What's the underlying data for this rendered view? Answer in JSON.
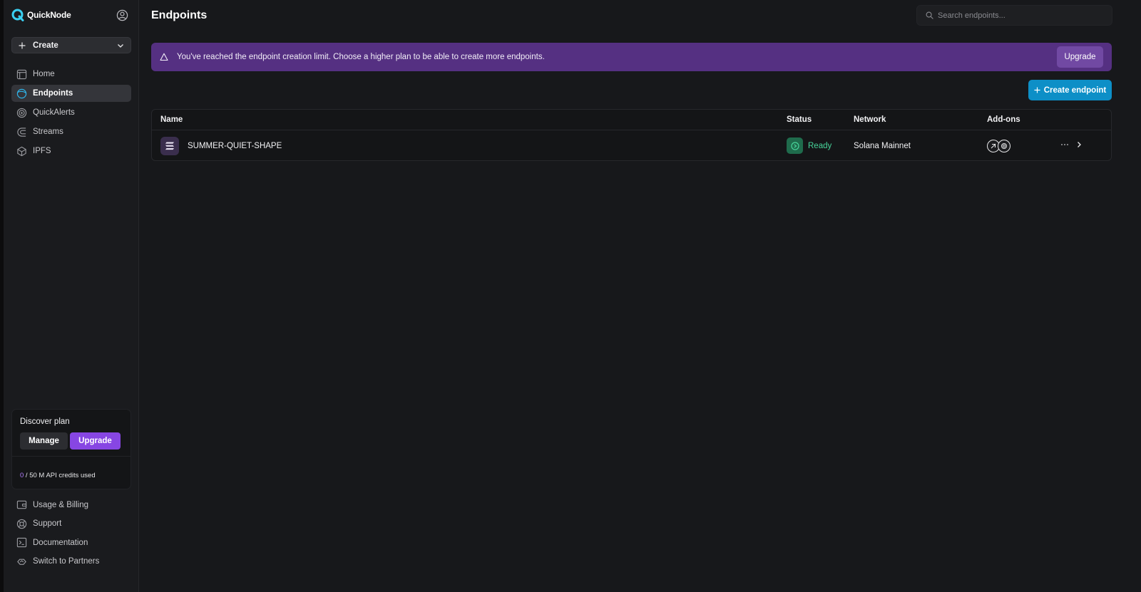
{
  "brand": {
    "name": "QuickNode"
  },
  "sidebar": {
    "create_label": "Create",
    "items": [
      {
        "label": "Home",
        "icon": "home-icon"
      },
      {
        "label": "Endpoints",
        "icon": "endpoints-icon",
        "active": true
      },
      {
        "label": "QuickAlerts",
        "icon": "quickalerts-icon"
      },
      {
        "label": "Streams",
        "icon": "streams-icon"
      },
      {
        "label": "IPFS",
        "icon": "ipfs-icon"
      }
    ],
    "plan": {
      "title": "Discover plan",
      "manage_label": "Manage",
      "upgrade_label": "Upgrade",
      "credits_used": "0",
      "credits_rest": " / 50 M API credits used"
    },
    "bottom_items": [
      {
        "label": "Usage & Billing",
        "icon": "billing-icon"
      },
      {
        "label": "Support",
        "icon": "support-icon"
      },
      {
        "label": "Documentation",
        "icon": "documentation-icon"
      },
      {
        "label": "Switch to Partners",
        "icon": "partners-icon"
      }
    ]
  },
  "header": {
    "title": "Endpoints",
    "search_placeholder": "Search endpoints..."
  },
  "banner": {
    "message": "You've reached the endpoint creation limit. Choose a higher plan to be able to create more endpoints.",
    "button_label": "Upgrade"
  },
  "actions": {
    "create_endpoint_label": "Create endpoint"
  },
  "table": {
    "columns": {
      "name": "Name",
      "status": "Status",
      "network": "Network",
      "addons": "Add-ons"
    },
    "rows": [
      {
        "name": "SUMMER-QUIET-SHAPE",
        "status": "Ready",
        "network": "Solana Mainnet",
        "chain_icon": "solana-icon"
      }
    ]
  },
  "colors": {
    "accent": "#0d8fc7",
    "upgrade_purple": "#8746e3",
    "banner_bg": "#553082",
    "status_ready": "#47d49a"
  }
}
